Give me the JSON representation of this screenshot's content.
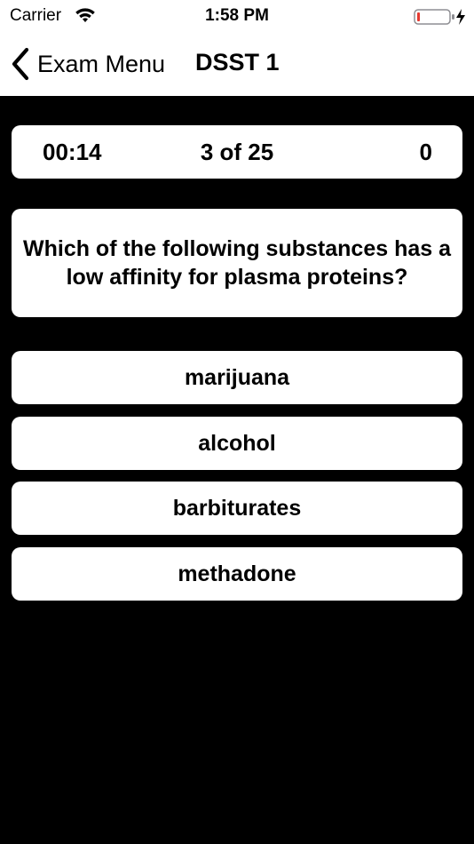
{
  "status_bar": {
    "carrier": "Carrier",
    "time": "1:58 PM"
  },
  "nav": {
    "back_label": "Exam Menu",
    "title": "DSST 1"
  },
  "exam": {
    "timer": "00:14",
    "progress": "3 of 25",
    "score": "0"
  },
  "question": {
    "text": "Which of the following substances has a low affinity for plasma proteins?"
  },
  "answers": [
    {
      "label": "marijuana"
    },
    {
      "label": "alcohol"
    },
    {
      "label": "barbiturates"
    },
    {
      "label": "methadone"
    }
  ],
  "colors": {
    "background": "#000000",
    "card": "#ffffff",
    "text": "#000000",
    "battery_low": "#e5392f"
  },
  "icons": {
    "back": "chevron-left-icon",
    "wifi": "wifi-icon",
    "battery": "battery-icon",
    "charging": "lightning-icon"
  }
}
